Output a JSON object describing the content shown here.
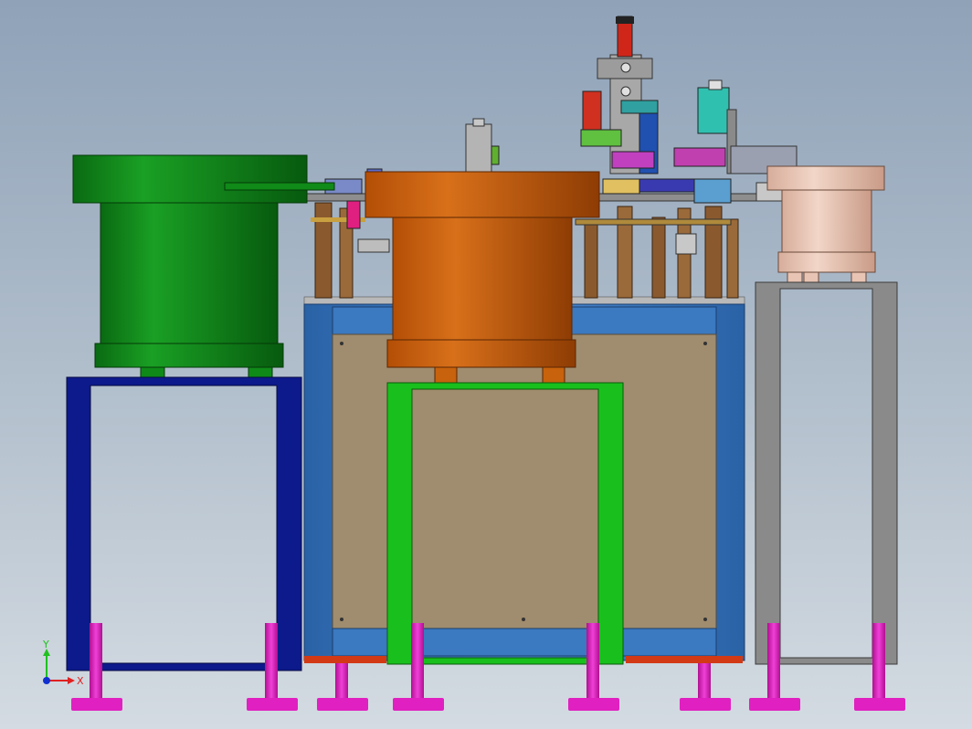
{
  "view": {
    "background_top": "#8fa2b8",
    "background_bottom": "#d4dbe2"
  },
  "components": {
    "green_feeder_color": "#0f8a18",
    "orange_feeder_color": "#c8620c",
    "pink_feeder_color": "#e8c4b4",
    "blue_stand_color": "#0d1a8c",
    "green_stand_color": "#19c01d",
    "grey_stand_color": "#8a8a8a",
    "main_cabinet_color": "#2f6fb5",
    "cabinet_panel_color": "#a08c6e",
    "leg_color": "#e020c0"
  },
  "triad": {
    "x_label": "X",
    "y_label": "Y",
    "x_color": "#e02020",
    "y_color": "#20c020",
    "origin_color": "#1030d0"
  }
}
